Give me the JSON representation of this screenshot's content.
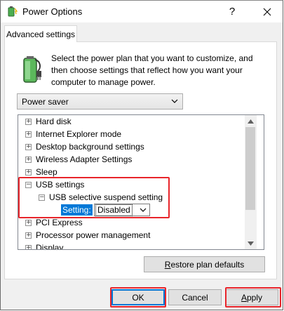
{
  "window": {
    "title": "Power Options",
    "help_glyph": "?",
    "close_icon": "close-icon"
  },
  "tab": {
    "label": "Advanced settings"
  },
  "description": "Select the power plan that you want to customize, and then choose settings that reflect how you want your computer to manage power.",
  "plan_select": {
    "value": "Power saver",
    "icon": "chevron-down-icon"
  },
  "tree": {
    "items": [
      {
        "label": "Hard disk",
        "expander": "+"
      },
      {
        "label": "Internet Explorer mode",
        "expander": "+"
      },
      {
        "label": "Desktop background settings",
        "expander": "+"
      },
      {
        "label": "Wireless Adapter Settings",
        "expander": "+"
      },
      {
        "label": "Sleep",
        "expander": "+"
      },
      {
        "label": "USB settings",
        "expander": "−"
      },
      {
        "label": "USB selective suspend setting",
        "expander": "−"
      },
      {
        "label": "PCI Express",
        "expander": "+"
      },
      {
        "label": "Processor power management",
        "expander": "+"
      },
      {
        "label": "Display",
        "expander": "+"
      }
    ],
    "setting_label": "Setting:",
    "setting_value": "Disabled"
  },
  "buttons": {
    "restore_pre": "",
    "restore_underline": "R",
    "restore_rest": "estore plan defaults",
    "ok": "OK",
    "cancel": "Cancel",
    "apply_underline": "A",
    "apply_rest": "pply"
  },
  "colors": {
    "highlight": "#e8252b",
    "selection": "#0078d7"
  }
}
